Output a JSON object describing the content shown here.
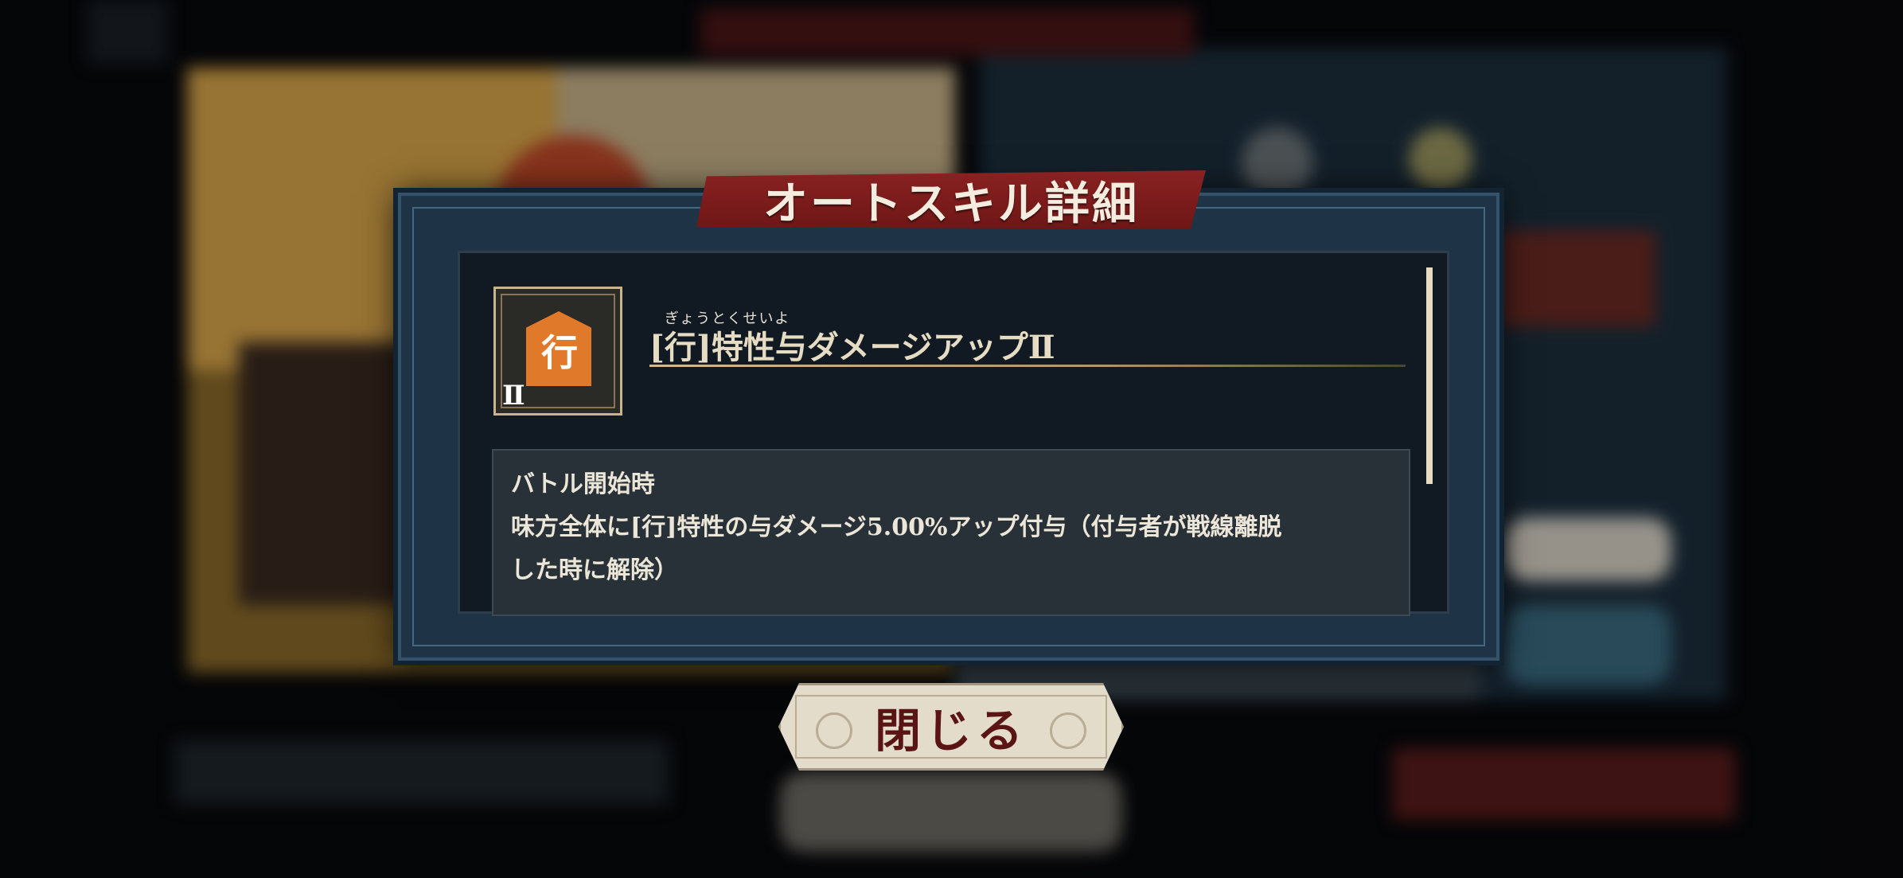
{
  "dialog": {
    "title": "オートスキル詳細",
    "skill": {
      "icon": "sword-hex-skill-icon",
      "icon_glyph": "行",
      "icon_rank": "Ⅱ",
      "furigana": "ぎょうとくせいよ",
      "name": "[行]特性与ダメージアップⅡ"
    },
    "description": {
      "line1": "バトル開始時",
      "line2": "味方全体に[行]特性の与ダメージ5.00%アップ付与（付与者が戦線離脱",
      "line3": "した時に解除）"
    },
    "close_button_label": "閉じる"
  },
  "colors": {
    "banner": "#7a1a1a",
    "frame": "#1f3346",
    "panel": "#111a22",
    "accent_gold": "#cdbb92",
    "button_text": "#5a1414"
  }
}
